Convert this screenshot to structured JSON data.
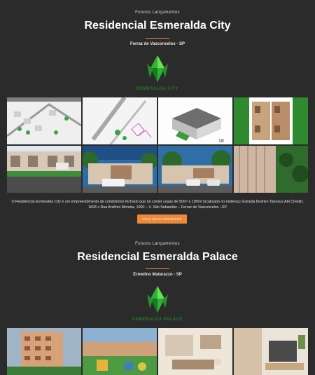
{
  "projects": [
    {
      "kicker": "Futuros Lançamentos",
      "title": "Residencial Esmeralda City",
      "location": "Ferraz de Vasconcelos - SP",
      "logo_text": "ESMERALDA CITY",
      "description": "O Residencial Esmeralda City é um empreendimento de condomínio fechado que irá conter casas de 50m² a 100m² localizado no endereço Estrada Ibrahim Tannous Abi Chedid, 1828 x Rua Antônio Moreira, 1900 – V. São Sebastião – Ferraz de Vasconcelos –SP",
      "button": "VEJA MAIS PROJETOS",
      "tiles": [
        "site-plan-1",
        "site-plan-2",
        "house-render-aerial",
        "floor-plan-aerial",
        "street-render",
        "house-front-car",
        "house-front-wide",
        "house-side-trees"
      ]
    },
    {
      "kicker": "Futuros Lançamentos",
      "title": "Residencial Esmeralda Palace",
      "location": "Ermelino Matarazzo - SP",
      "logo_text": "ESMERALDA PALACE",
      "tiles": [
        "building-exterior",
        "playground",
        "living-room",
        "kitchen"
      ]
    }
  ],
  "colors": {
    "background": "#2b2b2b",
    "accent": "#f0883a",
    "brand_green": "#1f7d2b"
  }
}
